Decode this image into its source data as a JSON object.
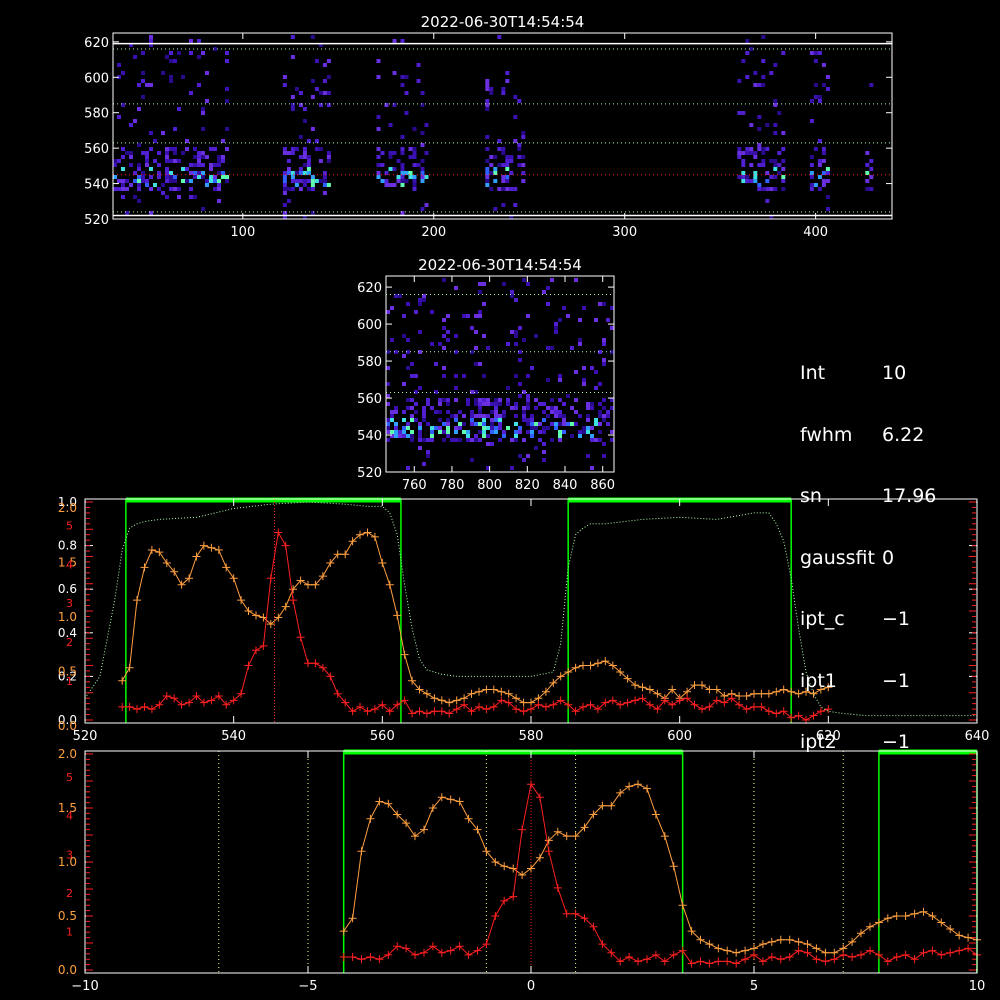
{
  "colors": {
    "background": "#000000",
    "axes": "#ffffff",
    "orange_series": "#ffa040",
    "red_series": "#ff2020",
    "green_band": "#00ff00",
    "green_dotted": "#b0ffb0",
    "yellow_dotted": "#ffff80",
    "red_dotted": "#ff2020"
  },
  "info_panel": [
    {
      "key": "Int",
      "value": "10"
    },
    {
      "key": "fwhm",
      "value": "6.22"
    },
    {
      "key": "sn",
      "value": "17.96"
    },
    {
      "key": "gaussfit",
      "value": "0"
    },
    {
      "key": "ipt_c",
      "value": "−1"
    },
    {
      "key": "ipt1",
      "value": "−1"
    },
    {
      "key": "ipt2",
      "value": "−1"
    }
  ],
  "chart_data": [
    {
      "type": "heatmap",
      "title": "2022-06-30T14:54:54",
      "xlim": [
        32,
        440
      ],
      "ylim": [
        520,
        625
      ],
      "xticks": [
        100,
        200,
        300,
        400
      ],
      "yticks": [
        520,
        540,
        560,
        580,
        600,
        620
      ],
      "hlines_green": [
        524,
        563,
        585,
        616
      ],
      "hline_red": 545,
      "white_lines": [
        522,
        619
      ],
      "columns": [
        {
          "x0": 32,
          "x1": 91
        },
        {
          "x0": 121,
          "x1": 146
        },
        {
          "x0": 170,
          "x1": 197
        },
        {
          "x0": 227,
          "x1": 246
        },
        {
          "x0": 359,
          "x1": 384
        },
        {
          "x0": 397,
          "x1": 406
        },
        {
          "x0": 426,
          "x1": 430
        }
      ]
    },
    {
      "type": "heatmap",
      "title": "2022-06-30T14:54:54",
      "xlim": [
        745,
        866
      ],
      "ylim": [
        520,
        626
      ],
      "xticks": [
        760,
        780,
        800,
        820,
        840,
        860
      ],
      "yticks": [
        520,
        540,
        560,
        580,
        600,
        620
      ],
      "hlines_green": [
        563,
        585,
        616
      ]
    },
    {
      "type": "line",
      "xlim": [
        520,
        640
      ],
      "xticks": [
        520,
        540,
        560,
        580,
        600,
        620,
        640
      ],
      "left_ticks_white": [
        "0.0",
        "0.2",
        "0.4",
        "0.6",
        "0.8",
        "1.0"
      ],
      "left_ticks_orange": [
        "0.0",
        "0.5",
        "1.0",
        "1.5",
        "2.0"
      ],
      "left_ticks_red": [
        "1",
        "2",
        "3",
        "4",
        "5"
      ],
      "green_bands": [
        [
          525.5,
          562.5
        ],
        [
          585,
          615
        ]
      ],
      "red_vline": 545.5,
      "series": [
        {
          "color": "orange",
          "x": [
            525,
            526,
            527,
            528,
            529,
            530,
            531,
            532,
            533,
            534,
            535,
            536,
            537,
            538,
            539,
            540,
            541,
            542,
            543,
            544,
            545,
            546,
            547,
            548,
            549,
            550,
            551,
            552,
            553,
            554,
            555,
            556,
            557,
            558,
            559,
            560,
            561,
            562,
            563,
            564,
            565,
            566,
            567,
            568,
            569,
            570,
            571,
            572,
            573,
            574,
            575,
            576,
            577,
            578,
            579,
            580,
            581,
            582,
            583,
            584,
            585,
            586,
            587,
            588,
            589,
            590,
            591,
            592,
            593,
            594,
            595,
            596,
            597,
            598,
            599,
            600,
            601,
            602,
            603,
            604,
            605,
            606,
            607,
            608,
            609,
            610,
            611,
            612,
            613,
            614,
            615,
            616,
            617,
            618,
            619,
            620
          ],
          "values": [
            0.18,
            0.24,
            0.55,
            0.7,
            0.78,
            0.77,
            0.72,
            0.68,
            0.62,
            0.65,
            0.75,
            0.8,
            0.79,
            0.78,
            0.7,
            0.65,
            0.55,
            0.5,
            0.48,
            0.47,
            0.44,
            0.47,
            0.52,
            0.6,
            0.64,
            0.62,
            0.62,
            0.66,
            0.72,
            0.76,
            0.76,
            0.82,
            0.85,
            0.86,
            0.84,
            0.72,
            0.62,
            0.48,
            0.3,
            0.18,
            0.14,
            0.12,
            0.1,
            0.09,
            0.08,
            0.09,
            0.1,
            0.12,
            0.13,
            0.14,
            0.14,
            0.13,
            0.12,
            0.1,
            0.08,
            0.08,
            0.1,
            0.13,
            0.17,
            0.2,
            0.22,
            0.24,
            0.25,
            0.25,
            0.26,
            0.27,
            0.25,
            0.22,
            0.19,
            0.16,
            0.15,
            0.14,
            0.12,
            0.1,
            0.14,
            0.1,
            0.13,
            0.16,
            0.16,
            0.14,
            0.14,
            0.11,
            0.12,
            0.11,
            0.11,
            0.12,
            0.12,
            0.12,
            0.13,
            0.14,
            0.13,
            0.12,
            0.13,
            0.12,
            0.14,
            0.15
          ]
        },
        {
          "color": "red",
          "x": [
            525,
            526,
            527,
            528,
            529,
            530,
            531,
            532,
            533,
            534,
            535,
            536,
            537,
            538,
            539,
            540,
            541,
            542,
            543,
            544,
            545,
            546,
            547,
            548,
            549,
            550,
            551,
            552,
            553,
            554,
            555,
            556,
            557,
            558,
            559,
            560,
            561,
            562,
            563,
            564,
            565,
            566,
            567,
            568,
            569,
            570,
            571,
            572,
            573,
            574,
            575,
            576,
            577,
            578,
            579,
            580,
            581,
            582,
            583,
            584,
            585,
            586,
            587,
            588,
            589,
            590,
            591,
            592,
            593,
            594,
            595,
            596,
            597,
            598,
            599,
            600,
            601,
            602,
            603,
            604,
            605,
            606,
            607,
            608,
            609,
            610,
            611,
            612,
            613,
            614,
            615,
            616,
            617,
            618,
            619,
            620
          ],
          "values": [
            0.06,
            0.06,
            0.05,
            0.06,
            0.05,
            0.07,
            0.11,
            0.1,
            0.07,
            0.08,
            0.11,
            0.08,
            0.09,
            0.11,
            0.07,
            0.09,
            0.12,
            0.25,
            0.32,
            0.34,
            0.65,
            0.86,
            0.8,
            0.55,
            0.38,
            0.26,
            0.26,
            0.24,
            0.2,
            0.12,
            0.08,
            0.04,
            0.06,
            0.04,
            0.05,
            0.07,
            0.04,
            0.07,
            0.09,
            0.03,
            0.04,
            0.03,
            0.04,
            0.04,
            0.03,
            0.05,
            0.07,
            0.04,
            0.06,
            0.05,
            0.06,
            0.09,
            0.08,
            0.05,
            0.04,
            0.05,
            0.07,
            0.06,
            0.07,
            0.09,
            0.07,
            0.04,
            0.06,
            0.07,
            0.05,
            0.08,
            0.09,
            0.07,
            0.08,
            0.09,
            0.1,
            0.07,
            0.05,
            0.09,
            0.07,
            0.09,
            0.1,
            0.07,
            0.05,
            0.06,
            0.09,
            0.08,
            0.1,
            0.07,
            0.05,
            0.06,
            0.06,
            0.04,
            0.03,
            0.04,
            0.01,
            0.02,
            0.0,
            0.02,
            0.04,
            0.05
          ]
        },
        {
          "color": "green-dotted",
          "x": [
            520,
            522,
            524,
            525,
            526,
            527,
            528,
            530,
            535,
            540,
            545,
            550,
            555,
            558,
            560,
            561,
            562,
            563,
            564,
            565,
            566,
            568,
            570,
            575,
            580,
            583,
            584,
            585,
            586,
            587,
            588,
            590,
            595,
            600,
            605,
            610,
            612,
            613,
            614,
            615,
            616,
            617,
            618,
            619,
            620,
            622,
            625,
            630,
            635,
            640
          ],
          "values": [
            0.1,
            0.2,
            0.55,
            0.78,
            0.88,
            0.9,
            0.91,
            0.92,
            0.93,
            0.97,
            0.99,
            1.0,
            0.99,
            0.98,
            0.98,
            0.95,
            0.85,
            0.62,
            0.42,
            0.28,
            0.23,
            0.21,
            0.2,
            0.2,
            0.2,
            0.22,
            0.35,
            0.7,
            0.85,
            0.88,
            0.9,
            0.9,
            0.92,
            0.93,
            0.92,
            0.95,
            0.95,
            0.9,
            0.82,
            0.65,
            0.42,
            0.22,
            0.12,
            0.06,
            0.04,
            0.03,
            0.02,
            0.02,
            0.02,
            0.02
          ]
        }
      ]
    },
    {
      "type": "line",
      "xlim": [
        -10,
        10
      ],
      "xticks": [
        -10,
        -5,
        0,
        5,
        10
      ],
      "left_ticks_orange": [
        "0.0",
        "0.5",
        "1.0",
        "1.5",
        "2.0"
      ],
      "left_ticks_red": [
        "1",
        "2",
        "3",
        "4",
        "5"
      ],
      "green_bands": [
        [
          -4.2,
          3.4
        ],
        [
          7.8,
          10
        ]
      ],
      "yellow_vlines": [
        -7,
        -5,
        -1,
        1,
        5,
        7
      ],
      "red_vline": 0,
      "series": [
        {
          "color": "orange",
          "x_start": -4.2,
          "x_step": 0.2,
          "values": [
            0.18,
            0.24,
            0.55,
            0.7,
            0.78,
            0.77,
            0.72,
            0.68,
            0.62,
            0.65,
            0.75,
            0.8,
            0.79,
            0.78,
            0.7,
            0.65,
            0.55,
            0.5,
            0.48,
            0.47,
            0.44,
            0.47,
            0.52,
            0.6,
            0.64,
            0.62,
            0.62,
            0.66,
            0.72,
            0.76,
            0.76,
            0.82,
            0.85,
            0.86,
            0.84,
            0.72,
            0.62,
            0.48,
            0.3,
            0.18,
            0.14,
            0.12,
            0.1,
            0.09,
            0.08,
            0.09,
            0.1,
            0.12,
            0.13,
            0.14,
            0.14,
            0.13,
            0.12,
            0.1,
            0.08,
            0.08,
            0.1,
            0.13,
            0.17,
            0.2,
            0.22,
            0.24,
            0.25,
            0.25,
            0.26,
            0.27,
            0.25,
            0.22,
            0.19,
            0.16,
            0.15,
            0.14
          ]
        },
        {
          "color": "red",
          "x_start": -4.2,
          "x_step": 0.2,
          "values": [
            0.06,
            0.06,
            0.05,
            0.06,
            0.05,
            0.07,
            0.11,
            0.1,
            0.07,
            0.08,
            0.11,
            0.08,
            0.09,
            0.11,
            0.07,
            0.09,
            0.12,
            0.25,
            0.32,
            0.34,
            0.65,
            0.86,
            0.8,
            0.55,
            0.38,
            0.26,
            0.26,
            0.24,
            0.2,
            0.12,
            0.08,
            0.04,
            0.06,
            0.04,
            0.05,
            0.07,
            0.04,
            0.07,
            0.09,
            0.03,
            0.04,
            0.03,
            0.04,
            0.04,
            0.03,
            0.05,
            0.07,
            0.04,
            0.06,
            0.05,
            0.06,
            0.09,
            0.08,
            0.05,
            0.04,
            0.05,
            0.07,
            0.06,
            0.07,
            0.09,
            0.07,
            0.04,
            0.06,
            0.07,
            0.05,
            0.08,
            0.09,
            0.07,
            0.08,
            0.09,
            0.1,
            0.07
          ]
        }
      ]
    }
  ]
}
